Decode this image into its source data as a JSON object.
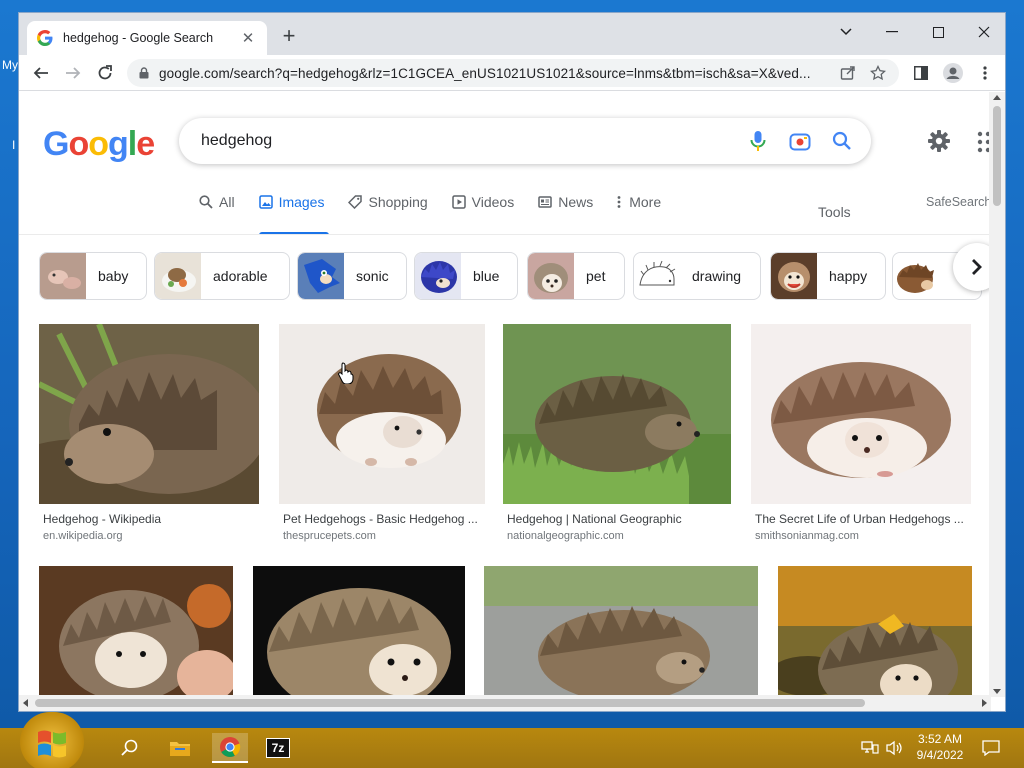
{
  "desktop": {
    "label_top": "My",
    "label_mid": "I"
  },
  "browser": {
    "tab_title": "hedgehog - Google Search",
    "url": "google.com/search?q=hedgehog&rlz=1C1GCEA_enUS1021US1021&source=lnms&tbm=isch&sa=X&ved...",
    "colors": {
      "tabbar": "#dee1e6",
      "accent": "#1a73e8"
    }
  },
  "google": {
    "logo": "Google",
    "query": "hedgehog",
    "tabs": [
      {
        "label": "All",
        "icon": "search-icon"
      },
      {
        "label": "Images",
        "icon": "image-icon"
      },
      {
        "label": "Shopping",
        "icon": "tag-icon"
      },
      {
        "label": "Videos",
        "icon": "play-icon"
      },
      {
        "label": "News",
        "icon": "newspaper-icon"
      },
      {
        "label": "More",
        "icon": "more-vert-icon"
      }
    ],
    "active_tab": "Images",
    "tools_label": "Tools",
    "safesearch_label": "SafeSearch",
    "chips": [
      "baby",
      "adorable",
      "sonic",
      "blue",
      "pet",
      "drawing",
      "happy"
    ],
    "results": [
      {
        "title": "Hedgehog - Wikipedia",
        "source": "en.wikipedia.org"
      },
      {
        "title": "Pet Hedgehogs - Basic Hedgehog ...",
        "source": "thesprucepets.com"
      },
      {
        "title": "Hedgehog | National Geographic",
        "source": "nationalgeographic.com"
      },
      {
        "title": "The Secret Life of Urban Hedgehogs ...",
        "source": "smithsonianmag.com"
      }
    ]
  },
  "taskbar": {
    "time": "3:52 AM",
    "date": "9/4/2022",
    "sevenzip_label": "7z"
  }
}
